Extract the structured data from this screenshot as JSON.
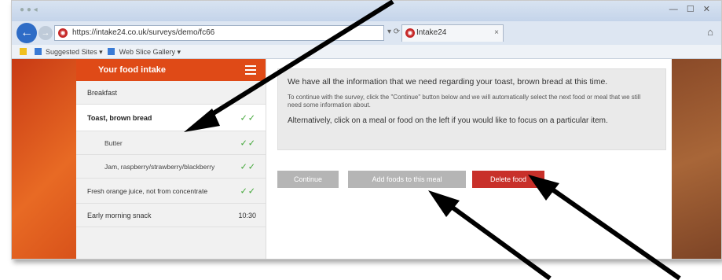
{
  "browser": {
    "address": "https://intake24.co.uk/surveys/demo/fc66",
    "tab_title": "Intake24",
    "favorites": [
      "Suggested Sites",
      "Web Slice Gallery"
    ],
    "window_controls": "— ☐ ✕"
  },
  "sidebar": {
    "title": "Your food intake",
    "items": [
      {
        "label": "Breakfast",
        "kind": "meal"
      },
      {
        "label": "Toast, brown bread",
        "kind": "food-selected",
        "status": "✓✓"
      },
      {
        "label": "Butter",
        "kind": "sub",
        "status": "✓✓"
      },
      {
        "label": "Jam, raspberry/strawberry/blackberry",
        "kind": "sub",
        "status": "✓✓"
      },
      {
        "label": "Fresh orange juice, not from concentrate",
        "kind": "food",
        "status": "✓✓"
      },
      {
        "label": "Early morning snack",
        "kind": "meal",
        "time": "10:30"
      }
    ]
  },
  "info": {
    "p1": "We have all the information that we need regarding your toast, brown bread at this time.",
    "p2": "To continue with the survey, click the \"Continue\" button below and we will automatically select the next food or meal that we still need some information about.",
    "p3": "Alternatively, click on a meal or food on the left if you would like to focus on a particular item."
  },
  "buttons": {
    "continue": "Continue",
    "add_foods": "Add foods to this meal",
    "delete_food": "Delete food"
  },
  "colors": {
    "accent": "#df4a17",
    "delete": "#c8302a",
    "check": "#3fa535",
    "disabled": "#b5b5b5"
  }
}
